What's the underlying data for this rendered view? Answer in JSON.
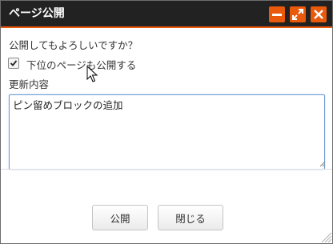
{
  "dialog": {
    "title": "ページ公開",
    "accent_color": "#e8590c",
    "titlebar_color": "#222222",
    "controls": {
      "minimize_icon": "minimize-icon",
      "maximize_icon": "maximize-icon",
      "close_icon": "close-icon"
    }
  },
  "body": {
    "question": "公開してもよろしいですか？",
    "subpages_checkbox": {
      "label": "下位のページも公開する",
      "checked": true
    },
    "update_field": {
      "label": "更新内容",
      "value": "ピン留めブロックの追加"
    }
  },
  "buttons": {
    "publish_label": "公開",
    "close_label": "閉じる"
  }
}
